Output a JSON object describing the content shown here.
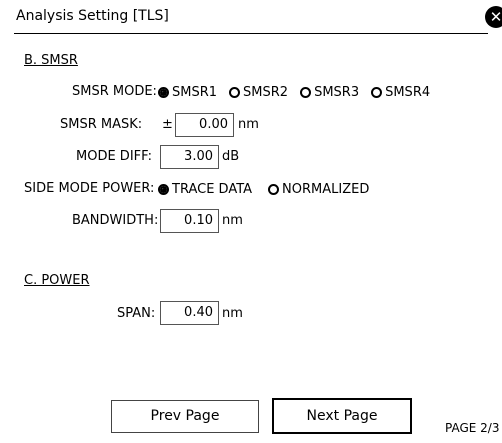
{
  "window": {
    "title": "Analysis Setting [TLS]",
    "close_icon": "close-circle-icon"
  },
  "section_b": {
    "heading": "B. SMSR",
    "smsr_mode": {
      "label": "SMSR MODE:",
      "options": [
        "SMSR1",
        "SMSR2",
        "SMSR3",
        "SMSR4"
      ],
      "selected": "SMSR1"
    },
    "smsr_mask": {
      "label": "SMSR MASK:",
      "prefix": "±",
      "value": "0.00",
      "unit": "nm"
    },
    "mode_diff": {
      "label": "MODE DIFF:",
      "value": "3.00",
      "unit": "dB"
    },
    "side_mode_power": {
      "label": "SIDE MODE POWER:",
      "options": [
        "TRACE DATA",
        "NORMALIZED"
      ],
      "selected": "TRACE DATA"
    },
    "bandwidth": {
      "label": "BANDWIDTH:",
      "value": "0.10",
      "unit": "nm"
    }
  },
  "section_c": {
    "heading": "C. POWER",
    "span": {
      "label": "SPAN:",
      "value": "0.40",
      "unit": "nm"
    }
  },
  "footer": {
    "prev_label": "Prev Page",
    "next_label": "Next Page",
    "page_indicator": "PAGE 2/3"
  }
}
